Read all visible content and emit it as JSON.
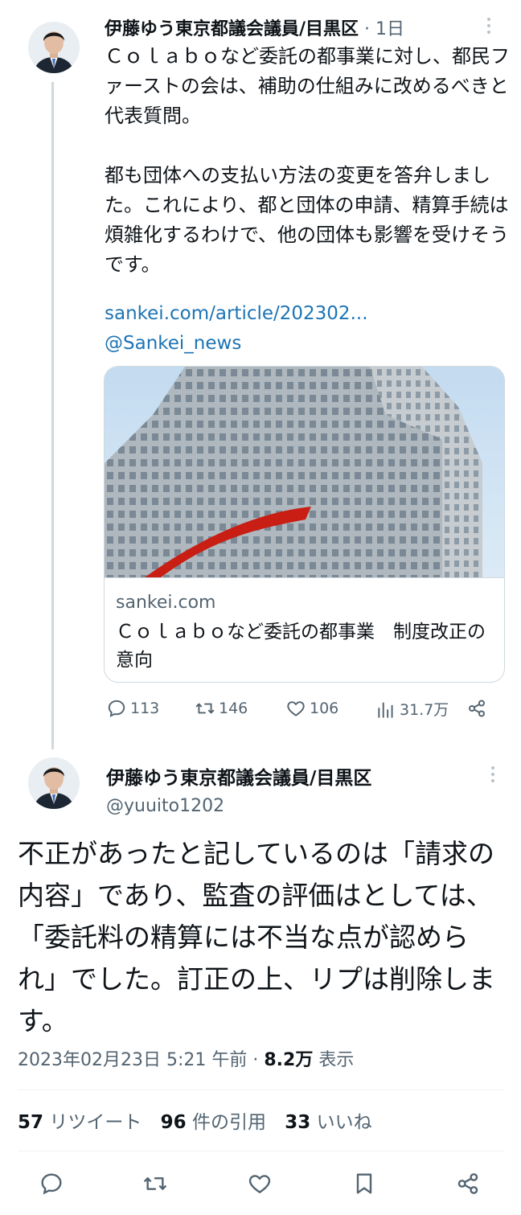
{
  "tweet1": {
    "author_name": "伊藤ゆう東京都議会議員/目黒区",
    "separator": " · ",
    "time": "1日",
    "text": "Ｃｏｌａｂｏなど委託の都事業に対し、都民ファーストの会は、補助の仕組みに改めるべきと代表質問。\n\n都も団体への支払い方法の変更を答弁しました。これにより、都と団体の申請、精算手続は煩雑化するわけで、他の団体も影響を受けそうです。",
    "link": "sankei.com/article/202302...",
    "mention": "@Sankei_news",
    "card": {
      "domain": "sankei.com",
      "title": "Ｃｏｌａｂｏなど委託の都事業　制度改正の意向"
    },
    "actions": {
      "reply_count": "113",
      "retweet_count": "146",
      "like_count": "106",
      "views_count": "31.7万"
    }
  },
  "tweet2": {
    "author_name": "伊藤ゆう東京都議会議員/目黒区",
    "handle": "@yuuito1202",
    "text": "不正があったと記しているのは「請求の内容」であり、監査の評価はとしては、「委託料の精算には不当な点が認められ」でした。訂正の上、リプは削除します。",
    "timestamp": "2023年02月23日 5:21 午前",
    "separator": " · ",
    "views": "8.2万",
    "views_label": " 表示",
    "stats": {
      "retweets_count": "57",
      "retweets_label": " リツイート",
      "quotes_count": "96",
      "quotes_label": " 件の引用",
      "likes_count": "33",
      "likes_label": " いいね"
    }
  },
  "icons": [
    "reply-icon",
    "retweet-icon",
    "like-icon",
    "views-icon",
    "share-icon",
    "bookmark-icon",
    "more-icon"
  ],
  "colors": {
    "link": "#1d74b4",
    "secondary_text": "#536471",
    "border": "#cfd9de",
    "accent_red": "#c81e14"
  }
}
